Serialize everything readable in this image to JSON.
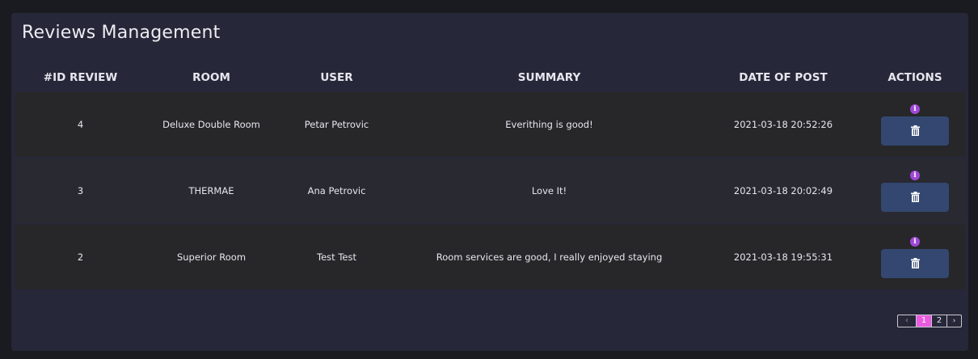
{
  "panel": {
    "title": "Reviews Management"
  },
  "table": {
    "headers": [
      "#ID REVIEW",
      "ROOM",
      "USER",
      "SUMMARY",
      "DATE OF POST",
      "ACTIONS"
    ],
    "rows": [
      {
        "id": "4",
        "room": "Deluxe Double Room",
        "user": "Petar Petrovic",
        "summary": "Everithing is good!",
        "date": "2021-03-18 20:52:26"
      },
      {
        "id": "3",
        "room": "THERMAE",
        "user": "Ana Petrovic",
        "summary": "Love It!",
        "date": "2021-03-18 20:02:49"
      },
      {
        "id": "2",
        "room": "Superior Room",
        "user": "Test Test",
        "summary": "Room services are good, I really enjoyed staying",
        "date": "2021-03-18 19:55:31"
      }
    ]
  },
  "actions": {
    "info_icon": "i",
    "info_icon_name": "info-icon",
    "delete_icon_name": "trash-icon"
  },
  "pagination": {
    "prev": "‹",
    "pages": [
      "1",
      "2"
    ],
    "current": "1",
    "next": "›"
  },
  "colors": {
    "panel_bg": "#262738",
    "accent_pink": "#e95ce0",
    "info_purple": "#9f48d6",
    "delete_blue": "#334770"
  }
}
